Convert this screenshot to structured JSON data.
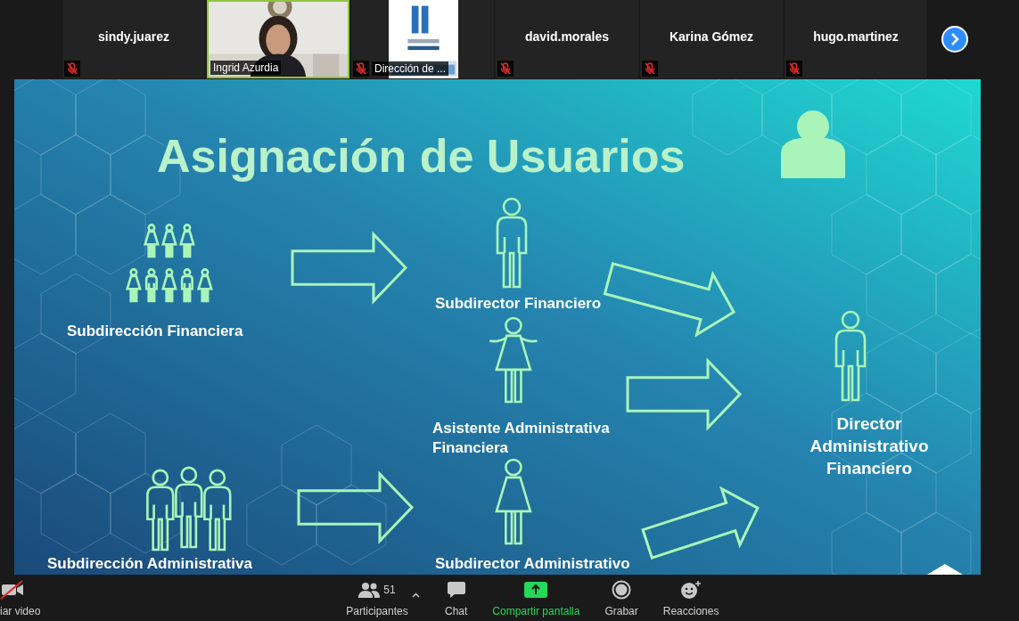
{
  "participants": [
    {
      "name": "sindy.juarez",
      "kind": "name",
      "muted": true,
      "active_speaker": false
    },
    {
      "name": "Ingrid Azurdia",
      "kind": "video",
      "muted": false,
      "active_speaker": true
    },
    {
      "name": "Dirección de ...",
      "kind": "video",
      "muted": true,
      "active_speaker": false
    },
    {
      "name": "david.morales",
      "kind": "name",
      "muted": true,
      "active_speaker": false
    },
    {
      "name": "Karina Gómez",
      "kind": "name",
      "muted": true,
      "active_speaker": false
    },
    {
      "name": "hugo.martinez",
      "kind": "name",
      "muted": true,
      "active_speaker": false
    }
  ],
  "slide": {
    "title": "Asignación de Usuarios",
    "units": [
      "Subdirección Financiera",
      "Subdirección Administrativa"
    ],
    "roles": [
      "Subdirector Financiero",
      "Asistente Administrativa Financiera",
      "Subdirector Administrativo"
    ],
    "target": "Director Administrativo Financiero"
  },
  "toolbar": {
    "video": {
      "label": "iar video",
      "off": true
    },
    "participants": {
      "label": "Participantes",
      "count": "51"
    },
    "items": [
      {
        "kind": "chat",
        "label": "Chat"
      },
      {
        "kind": "share",
        "label": "Compartir pantalla"
      },
      {
        "kind": "record",
        "label": "Grabar"
      },
      {
        "kind": "reactions",
        "label": "Reacciones"
      }
    ]
  }
}
